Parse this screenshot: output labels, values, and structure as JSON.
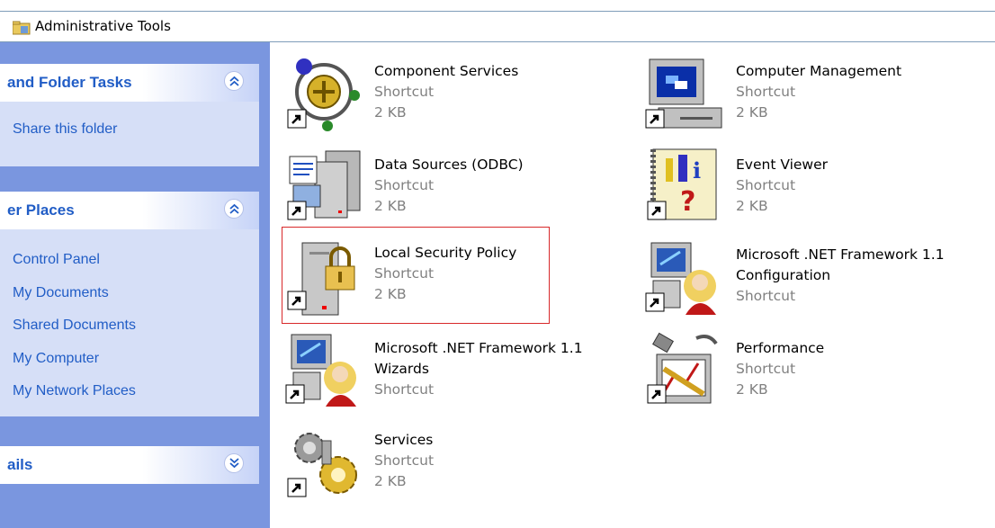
{
  "address_bar": {
    "title": "Administrative Tools",
    "icon": "admin-tools-folder-icon"
  },
  "task_panes": [
    {
      "title": "and Folder Tasks",
      "state": "expanded",
      "links": [
        "Share this folder"
      ]
    },
    {
      "title": "er Places",
      "state": "expanded",
      "links": [
        "Control Panel",
        "My Documents",
        "Shared Documents",
        "My Computer",
        "My Network Places"
      ]
    },
    {
      "title": "ails",
      "state": "collapsed",
      "links": []
    }
  ],
  "items": [
    {
      "name": "Component Services",
      "type": "Shortcut",
      "size": "2 KB",
      "icon": "component-services-icon"
    },
    {
      "name": "Computer Management",
      "type": "Shortcut",
      "size": "2 KB",
      "icon": "computer-management-icon"
    },
    {
      "name": "Data Sources (ODBC)",
      "type": "Shortcut",
      "size": "2 KB",
      "icon": "data-sources-odbc-icon"
    },
    {
      "name": "Event Viewer",
      "type": "Shortcut",
      "size": "2 KB",
      "icon": "event-viewer-icon"
    },
    {
      "name": "Local Security Policy",
      "type": "Shortcut",
      "size": "2 KB",
      "icon": "local-security-policy-icon",
      "highlighted": true
    },
    {
      "name_line1": "Microsoft .NET Framework 1.1",
      "name_line2": "Configuration",
      "type": "Shortcut",
      "icon": "net-framework-config-icon"
    },
    {
      "name_line1": "Microsoft .NET Framework 1.1",
      "name_line2": "Wizards",
      "type": "Shortcut",
      "icon": "net-framework-wizards-icon"
    },
    {
      "name": "Performance",
      "type": "Shortcut",
      "size": "2 KB",
      "icon": "performance-icon"
    },
    {
      "name": "Services",
      "type": "Shortcut",
      "size": "2 KB",
      "icon": "services-icon"
    }
  ],
  "colors": {
    "pane_bg": "#7a96df",
    "pane_body": "#d6dff7",
    "link": "#215dc6",
    "highlight_border": "#d8282a"
  }
}
